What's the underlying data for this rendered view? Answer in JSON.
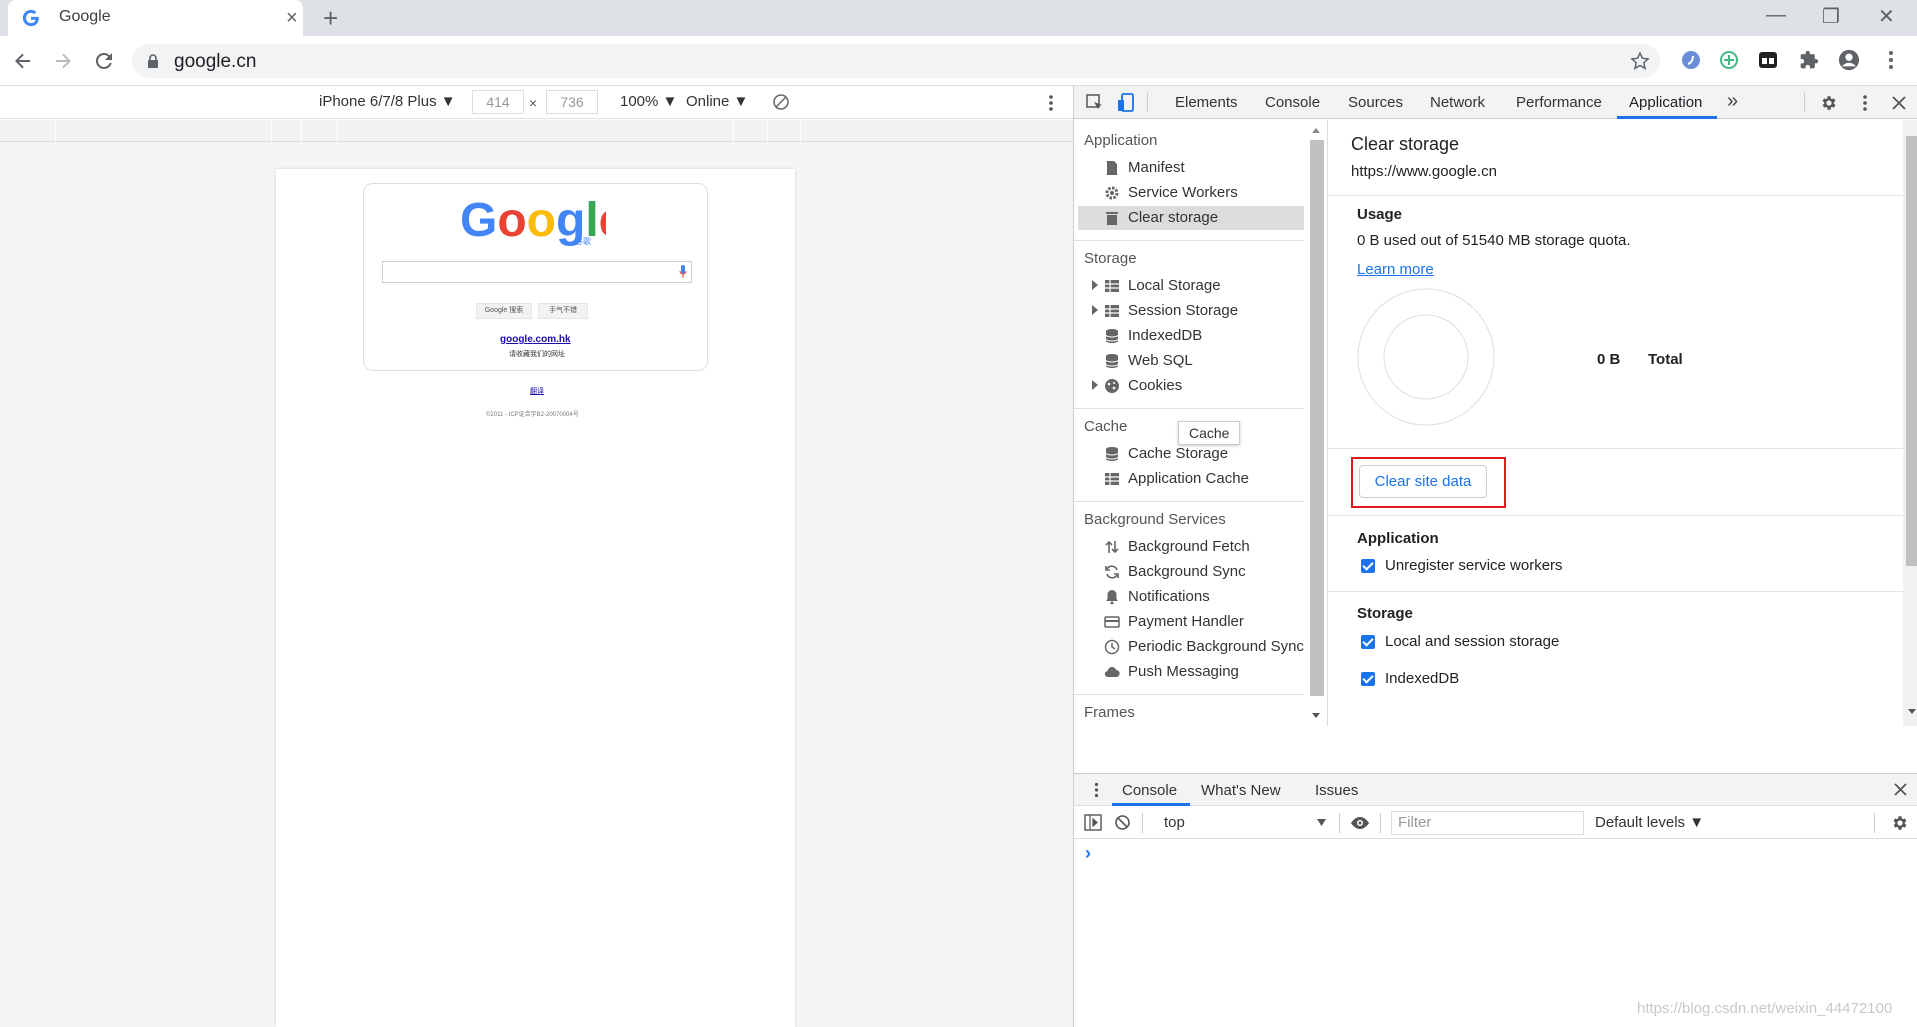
{
  "browser": {
    "tab_title": "Google",
    "tab_close": "×",
    "new_tab": "+",
    "url": "google.cn",
    "window_minimize": "—",
    "window_restore": "❐",
    "window_close": "✕"
  },
  "device_toolbar": {
    "device": "iPhone 6/7/8 Plus ▼",
    "width": "414",
    "times": "×",
    "height": "736",
    "zoom": "100% ▼",
    "network": "Online ▼"
  },
  "page": {
    "google_sub": "谷歌",
    "search_button": "Google 搜索",
    "lucky_button": "手气不错",
    "hk_link": "google.com.hk",
    "hk_text": "请收藏我们的网址",
    "footer_link": "翻译",
    "footer_text": "©2011 - ICP证合字B2-20070004号"
  },
  "devtools": {
    "tabs": [
      "Elements",
      "Console",
      "Sources",
      "Network",
      "Performance",
      "Application"
    ],
    "more_tabs": "»",
    "sidebar": {
      "application_title": "Application",
      "application_items": [
        "Manifest",
        "Service Workers",
        "Clear storage"
      ],
      "storage_title": "Storage",
      "storage_items": [
        "Local Storage",
        "Session Storage",
        "IndexedDB",
        "Web SQL",
        "Cookies"
      ],
      "cache_title": "Cache",
      "cache_items": [
        "Cache Storage",
        "Application Cache"
      ],
      "tooltip": "Cache",
      "bg_title": "Background Services",
      "bg_items": [
        "Background Fetch",
        "Background Sync",
        "Notifications",
        "Payment Handler",
        "Periodic Background Sync",
        "Push Messaging"
      ],
      "frames_title": "Frames"
    },
    "clear_storage": {
      "title": "Clear storage",
      "origin": "https://www.google.cn",
      "usage_title": "Usage",
      "usage_text": "0 B used out of 51540 MB storage quota.",
      "learn_more": "Learn more",
      "total_value": "0 B",
      "total_label": "Total",
      "clear_button": "Clear site data",
      "app_section": "Application",
      "app_option": "Unregister service workers",
      "storage_section": "Storage",
      "storage_options": [
        "Local and session storage",
        "IndexedDB"
      ]
    },
    "drawer": {
      "tabs": [
        "Console",
        "What's New",
        "Issues"
      ],
      "context": "top",
      "filter_placeholder": "Filter",
      "levels": "Default levels ▼",
      "prompt": "›"
    },
    "colors": {
      "accent": "#1a73e8",
      "highlight_box": "#e0191f"
    }
  },
  "watermark": "https://blog.csdn.net/weixin_44472100"
}
